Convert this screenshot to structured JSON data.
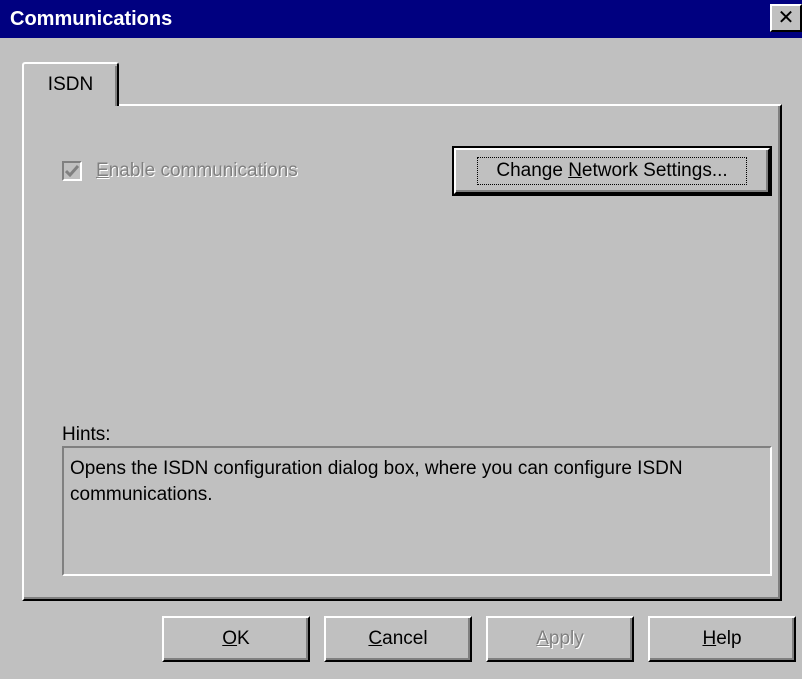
{
  "window": {
    "title": "Communications",
    "close_label": "✕"
  },
  "tabs": [
    {
      "label": "ISDN",
      "selected": true
    }
  ],
  "isdn": {
    "enable_checkbox": {
      "label_accesskey": "E",
      "label_rest": "nable communications",
      "checked": true,
      "enabled": false
    },
    "network_button": {
      "label_before": "Change ",
      "label_accesskey": "N",
      "label_after": "etwork Settings..."
    },
    "hints": {
      "label": "Hints:",
      "text": "Opens the ISDN configuration dialog box, where you can configure ISDN communications."
    }
  },
  "buttons": {
    "ok": {
      "accesskey": "O",
      "rest": "K"
    },
    "cancel": {
      "accesskey": "C",
      "rest": "ancel"
    },
    "apply": {
      "accesskey": "A",
      "rest": "pply",
      "enabled": false
    },
    "help": {
      "accesskey": "H",
      "rest": "elp"
    }
  },
  "colors": {
    "titlebar": "#000080",
    "face": "#c0c0c0",
    "disabled_text": "#808080"
  }
}
